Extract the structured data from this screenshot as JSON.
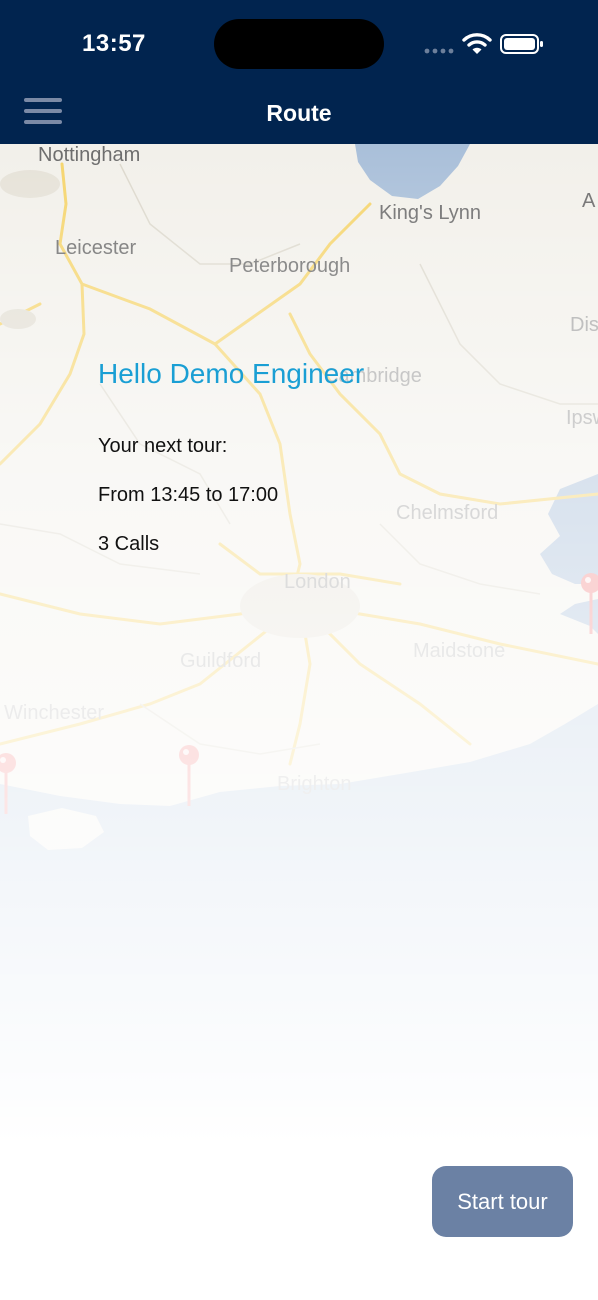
{
  "status_bar": {
    "time": "13:57",
    "icons": [
      "signal-dots-icon",
      "wifi-icon",
      "battery-icon"
    ]
  },
  "nav": {
    "title": "Route",
    "menu_icon": "hamburger-menu-icon"
  },
  "map": {
    "labels": {
      "nottingham": "Nottingham",
      "kings_lynn": "King's Lynn",
      "a_partial": "A",
      "leicester": "Leicester",
      "peterborough": "Peterborough",
      "dis_partial": "Dis",
      "cambridge": "Cambridge",
      "ipsw_partial": "Ipsw",
      "chelmsford": "Chelmsford",
      "london": "London",
      "guildford": "Guildford",
      "maidstone": "Maidstone",
      "winchester": "Winchester",
      "brighton": "Brighton"
    },
    "pin_icon": "map-pin-icon",
    "pin_color": "#f28a8a"
  },
  "greeting": {
    "title": "Hello Demo Engineer",
    "next_tour_label": "Your next tour:",
    "time_range": "From 13:45 to 17:00",
    "calls": "3 Calls"
  },
  "actions": {
    "start_tour": "Start tour"
  },
  "colors": {
    "nav_background": "#01244f",
    "greeting_text": "#1a9fd4",
    "button_background": "#6b81a4",
    "sea": "#a9bfd9",
    "land": "#f2f0ea",
    "roads": "#f5d46b"
  }
}
